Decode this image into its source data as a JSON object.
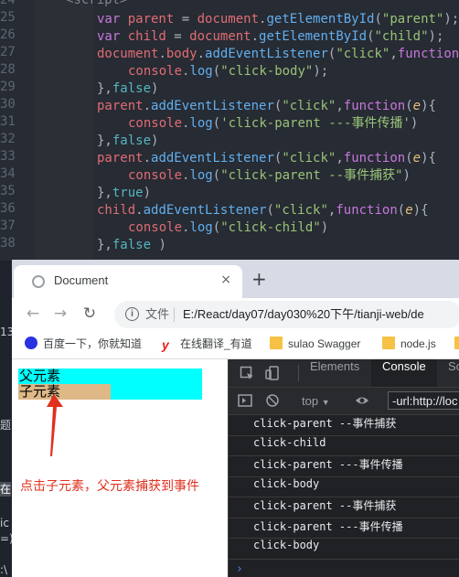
{
  "editor": {
    "line_numbers": [
      "24",
      "25",
      "26",
      "27",
      "28",
      "29",
      "30",
      "31",
      "32",
      "33",
      "34",
      "35",
      "36",
      "37",
      "38"
    ],
    "top_partial": "<script>",
    "lines": [
      [
        "var parent = document.getElementById(\"parent\");"
      ],
      [
        "var child = document.getElementById(\"child\");"
      ],
      [
        "document.body.addEventListener(\"click\",function"
      ],
      [
        "console.log(\"click-body\");"
      ],
      [
        "},false)"
      ],
      [
        "parent.addEventListener(\"click\",function(e){"
      ],
      [
        "console.log('click-parent ---事件传播')"
      ],
      [
        "},false)"
      ],
      [
        "parent.addEventListener(\"click\",function(e){"
      ],
      [
        "console.log(\"click-parent --事件捕获\")"
      ],
      [
        "},true)"
      ],
      [
        "child.addEventListener(\"click\",function(e){"
      ],
      [
        "console.log(\"click-child\")"
      ],
      [
        "},false )"
      ]
    ]
  },
  "browser": {
    "tab_title": "Document",
    "tab_close": "×",
    "new_tab": "+",
    "nav": {
      "back": "←",
      "forward": "→",
      "reload": "↻"
    },
    "omnibox": {
      "info": "i",
      "label": "文件",
      "url": "E:/React/day07/day030%20下午/tianji-web/de"
    },
    "bookmarks": [
      "百度一下，你就知道",
      "在线翻译_有道",
      "sulao Swagger",
      "node.js",
      "c"
    ],
    "page": {
      "parent_label": "父元素",
      "child_label": "子元素",
      "note": "点击子元素，父元素捕获到事件",
      "parent_color": "#00ffff",
      "child_color": "#deb887"
    },
    "devtools": {
      "tabs": [
        "Elements",
        "Console",
        "So"
      ],
      "active_tab": "Console",
      "context": "top",
      "filter": "-url:http://loc",
      "logs": [
        "click-parent --事件捕获",
        "click-child",
        "click-parent ---事件传播",
        "click-body",
        "click-parent --事件捕获",
        "click-parent ---事件传播",
        "click-body"
      ],
      "prompt": "›"
    }
  },
  "sidebar_fragments": [
    "13",
    "题",
    "在",
    "ic",
    "=)",
    ":\\"
  ]
}
